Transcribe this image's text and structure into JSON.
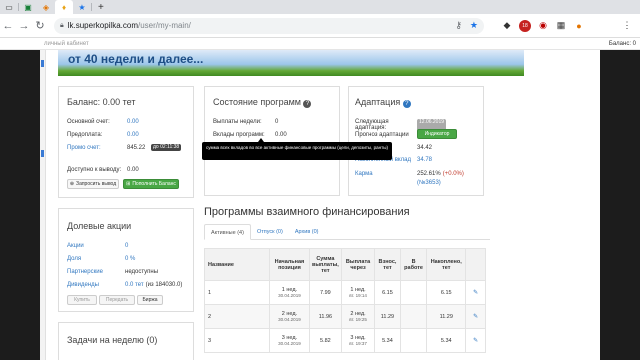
{
  "browser": {
    "tab_icons": [
      "page-icon",
      "sheets-icon",
      "extension-icon",
      "kopilka-icon",
      "star-icon"
    ],
    "new_tab": "+",
    "url_host": "lk.superkopilka.com",
    "url_path": "/user/my-main/",
    "ext_badge": "18",
    "bookmark_text": "личный кабинет",
    "bookmark_right": "Баланс: 0"
  },
  "banner": {
    "title": "от 40 недели и далее..."
  },
  "balance": {
    "title": "Баланс: 0.00 тет",
    "rows": [
      {
        "label": "Основной счет:",
        "value": "0.00"
      },
      {
        "label": "Предоплата:",
        "value": "0.00"
      },
      {
        "label": "Промо счет:",
        "value": "845.22",
        "tag": "до 02:11:38"
      }
    ],
    "withdraw_label": "Доступно к выводу:",
    "withdraw_value": "0.00",
    "request_btn": "Запросить вывод",
    "topup_btn": "Пополнить Баланс"
  },
  "program_state": {
    "title": "Состояние программ",
    "rows": [
      {
        "label": "Выплаты недели:",
        "value": "0"
      },
      {
        "label": "Вклады программ:",
        "value": "0.00"
      }
    ]
  },
  "tooltip": {
    "text": "сумма всех вкладов во все активные финансовые программы (цели, депозиты, ранты)"
  },
  "adaptation": {
    "title": "Адаптация",
    "next_label": "Следующая адаптация:",
    "next_date": "12.06.2019",
    "forecast_label": "Прогноз адаптации",
    "indicator_btn": "Индикатор",
    "rows": [
      {
        "label": "Капитал",
        "value": "34.42"
      },
      {
        "label": "Накопленный вклад",
        "value": "34.78"
      },
      {
        "label": "Карма",
        "value": "252.61%",
        "extra": "(+0.0%)",
        "extra2": "(№3653)"
      }
    ]
  },
  "shares": {
    "title": "Долевые акции",
    "rows": [
      {
        "label": "Акции",
        "value": "0"
      },
      {
        "label": "Доля",
        "value": "0 %"
      },
      {
        "label": "Партнерские",
        "value": "недоступны"
      },
      {
        "label": "Дивиденды",
        "value": "0.0 тет",
        "extra": "(из 184030.0)"
      }
    ],
    "buy_btn": "Купить",
    "transfer_btn": "Передать",
    "exchange_btn": "Биржа"
  },
  "tasks": {
    "title": "Задачи на неделю (0)"
  },
  "programs": {
    "title": "Программы взаимного финансирования",
    "tabs": [
      "Активные (4)",
      "Отпуск (0)",
      "Архив (0)"
    ],
    "headers": [
      "Название",
      "Начальная позиция",
      "Сумма выплаты, тет",
      "Выплата через",
      "Взнос, тет",
      "В работе",
      "Накоплено, тет",
      ""
    ],
    "rows": [
      {
        "name": "1",
        "start": "1 нед.",
        "start_date": "30.04.2019",
        "payout": "7.99",
        "after": "1 нед.",
        "after_sub": "вт. 19:14",
        "fee": "6.15",
        "work": "",
        "acc": "6.15"
      },
      {
        "name": "2",
        "start": "2 нед.",
        "start_date": "30.04.2019",
        "payout": "11.96",
        "after": "2 нед.",
        "after_sub": "вт. 19:25",
        "fee": "11.29",
        "work": "",
        "acc": "11.29"
      },
      {
        "name": "3",
        "start": "3 нед.",
        "start_date": "30.04.2019",
        "payout": "5.82",
        "after": "3 нед.",
        "after_sub": "вт. 19:37",
        "fee": "5.34",
        "work": "",
        "acc": "5.34"
      }
    ]
  },
  "colors": {
    "link": "#3077c0",
    "green": "#49a745",
    "dark": "#444444"
  }
}
